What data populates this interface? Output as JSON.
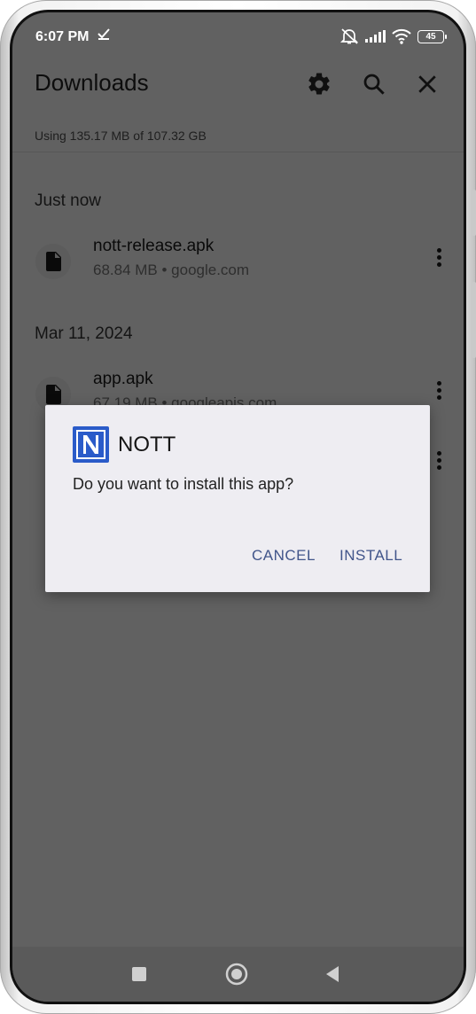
{
  "status_bar": {
    "time": "6:07 PM",
    "battery_level": "45",
    "icons": [
      "check-icon",
      "bell-off-icon",
      "signal-icon",
      "wifi-icon",
      "battery-icon"
    ]
  },
  "app_bar": {
    "title": "Downloads",
    "icons": [
      "settings-icon",
      "search-icon",
      "close-icon"
    ]
  },
  "storage": {
    "text": "Using 135.17 MB of 107.32 GB"
  },
  "sections": [
    {
      "header": "Just now",
      "items": [
        {
          "name": "nott-release.apk",
          "meta": "68.84 MB • google.com"
        }
      ]
    },
    {
      "header": "Mar 11, 2024",
      "items": [
        {
          "name": "app.apk",
          "meta": "67.19 MB • googleapis.com"
        }
      ]
    }
  ],
  "dialog": {
    "app_name": "NOTT",
    "logo_letter": "N",
    "message": "Do you want to install this app?",
    "cancel_label": "CANCEL",
    "install_label": "INSTALL"
  },
  "nav_bar": {
    "buttons": [
      "recents-icon",
      "home-icon",
      "back-icon"
    ]
  },
  "colors": {
    "scrim_background": "#616161",
    "dialog_background": "#eeedf2",
    "dialog_button_text": "#41558a",
    "app_logo": "#2a5bc9"
  }
}
